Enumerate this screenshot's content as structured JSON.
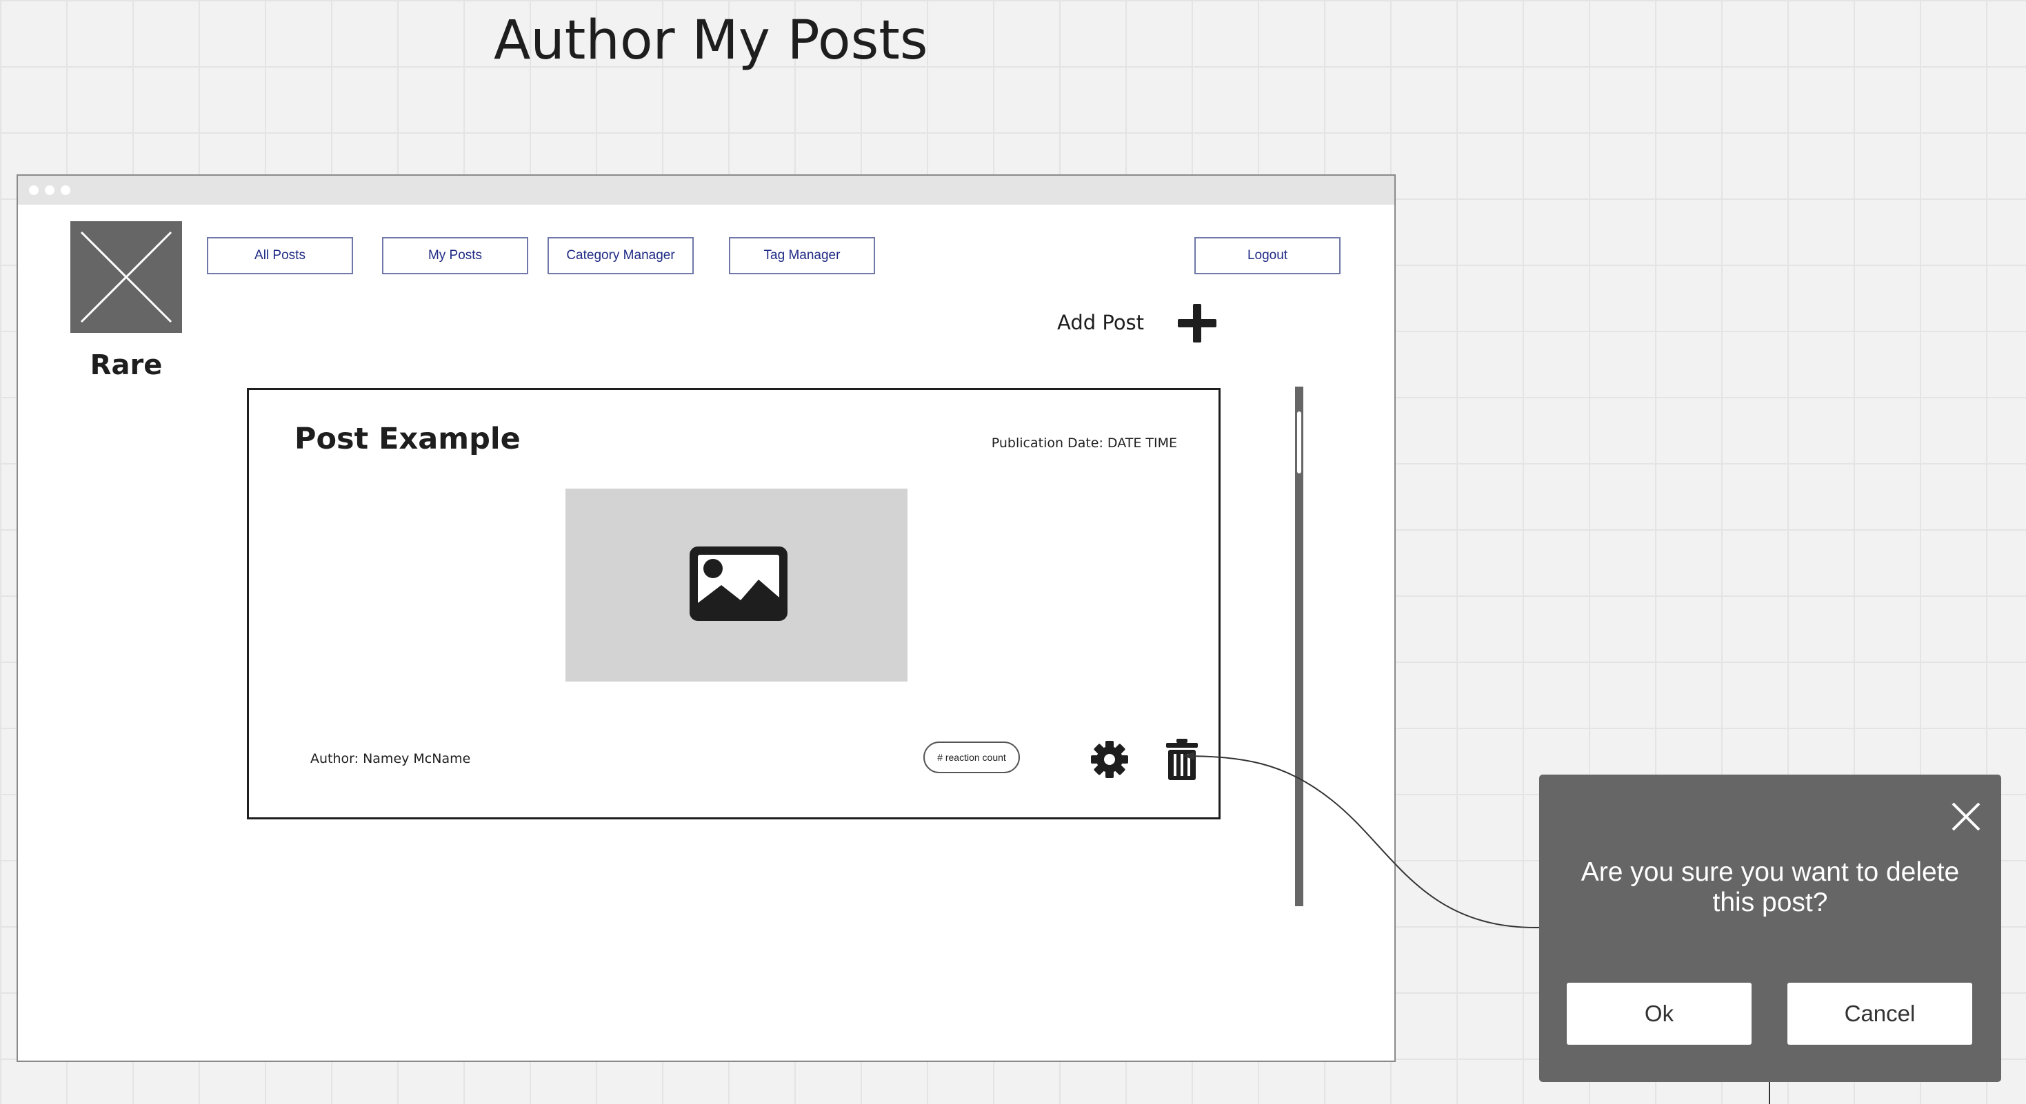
{
  "board": {
    "title": "Author My Posts"
  },
  "app": {
    "logo_text": "Rare",
    "logo_icon": "image-placeholder-icon"
  },
  "nav": {
    "items": [
      {
        "label": "All Posts"
      },
      {
        "label": "My Posts"
      },
      {
        "label": "Category Manager"
      },
      {
        "label": "Tag Manager"
      }
    ],
    "logout_label": "Logout"
  },
  "actions": {
    "add_post_label": "Add Post",
    "add_post_icon": "plus-icon"
  },
  "post": {
    "title": "Post Example",
    "publication_date": "Publication Date: DATE TIME",
    "image_icon": "image-icon",
    "author": "Author: Namey McName",
    "reaction_count": "# reaction count",
    "edit_icon": "gear-icon",
    "delete_icon": "trash-icon"
  },
  "dialog": {
    "message": "Are you sure you want to delete this post?",
    "ok_label": "Ok",
    "cancel_label": "Cancel",
    "close_icon": "close-icon"
  },
  "colors": {
    "canvas": "#f2f2f2",
    "gridline": "#e4e4e4",
    "nav_text": "#1f2a84",
    "nav_border": "#6f78a8",
    "placeholder_dark": "#666666",
    "image_placeholder": "#d3d3d3",
    "dialog_bg": "#666666",
    "text": "#1e1e1e"
  }
}
